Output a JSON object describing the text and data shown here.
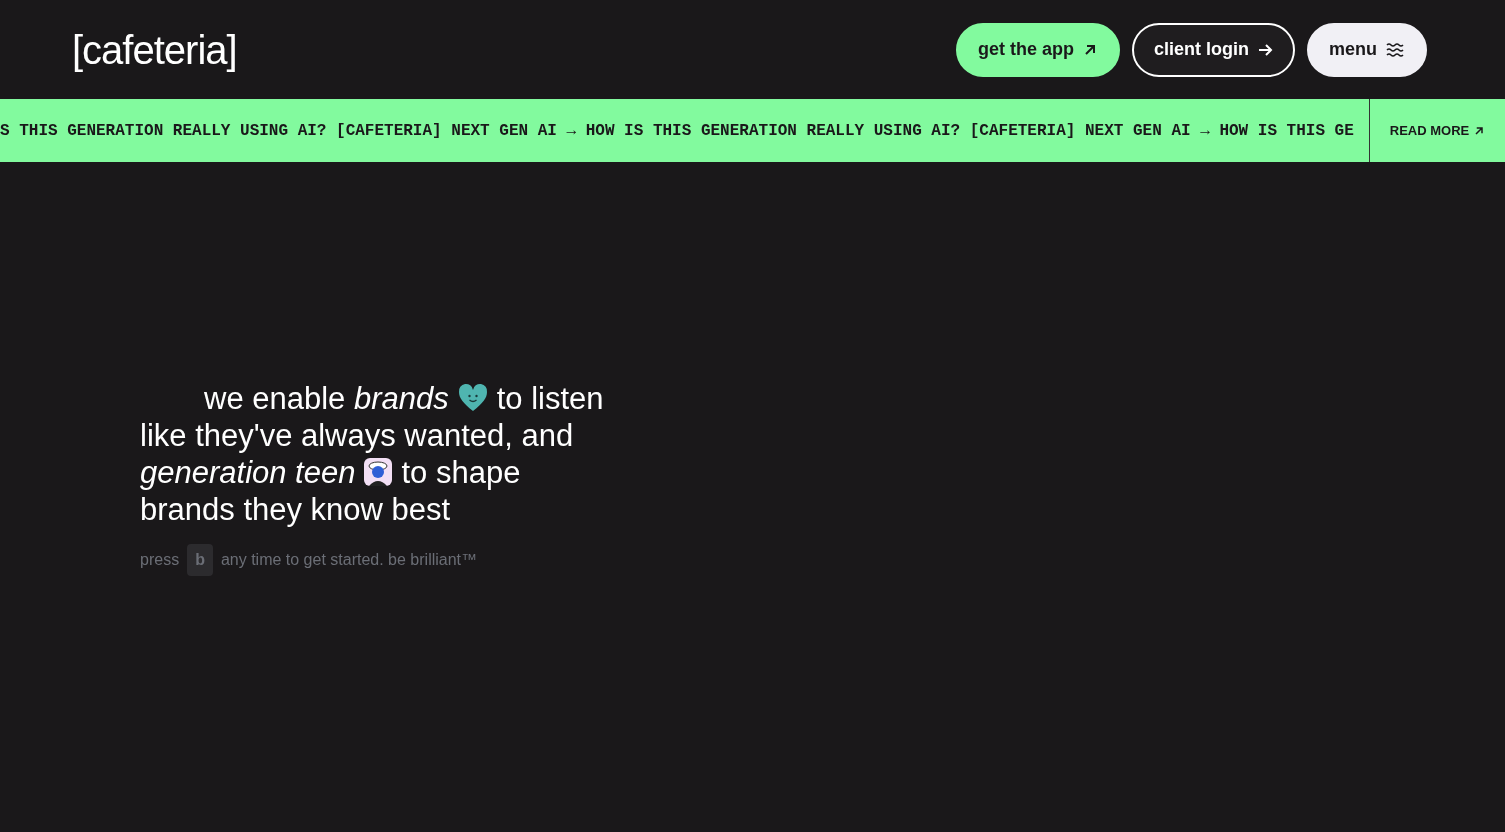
{
  "logo": "[cafeteria]",
  "nav": {
    "buttons": [
      {
        "label": "get the app",
        "kind": "primary"
      },
      {
        "label": "client login",
        "kind": "outline"
      },
      {
        "label": "menu",
        "kind": "light"
      }
    ]
  },
  "ticker": {
    "text": "S THIS GENERATION REALLY USING AI? [CAFETERIA] NEXT GEN AI → HOW IS THIS GENERATION REALLY USING AI? [CAFETERIA] NEXT GEN AI → HOW IS THIS GE",
    "link": "READ MORE"
  },
  "hero": {
    "lines": [
      [
        {
          "kind": "text",
          "text": "we enable *brands*"
        },
        {
          "kind": "heart"
        },
        {
          "kind": "text",
          "text": "to listen"
        }
      ],
      [
        {
          "kind": "text",
          "text": "like they've always wanted, and"
        }
      ],
      [
        {
          "kind": "text",
          "text": "*generation teen*"
        },
        {
          "kind": "teen"
        },
        {
          "kind": "text",
          "text": "to shape"
        }
      ],
      [
        {
          "kind": "text",
          "text": "brands they know best"
        }
      ]
    ],
    "hint": {
      "before": "press",
      "key": "b",
      "after": "any time to get started. be brilliant™"
    }
  }
}
